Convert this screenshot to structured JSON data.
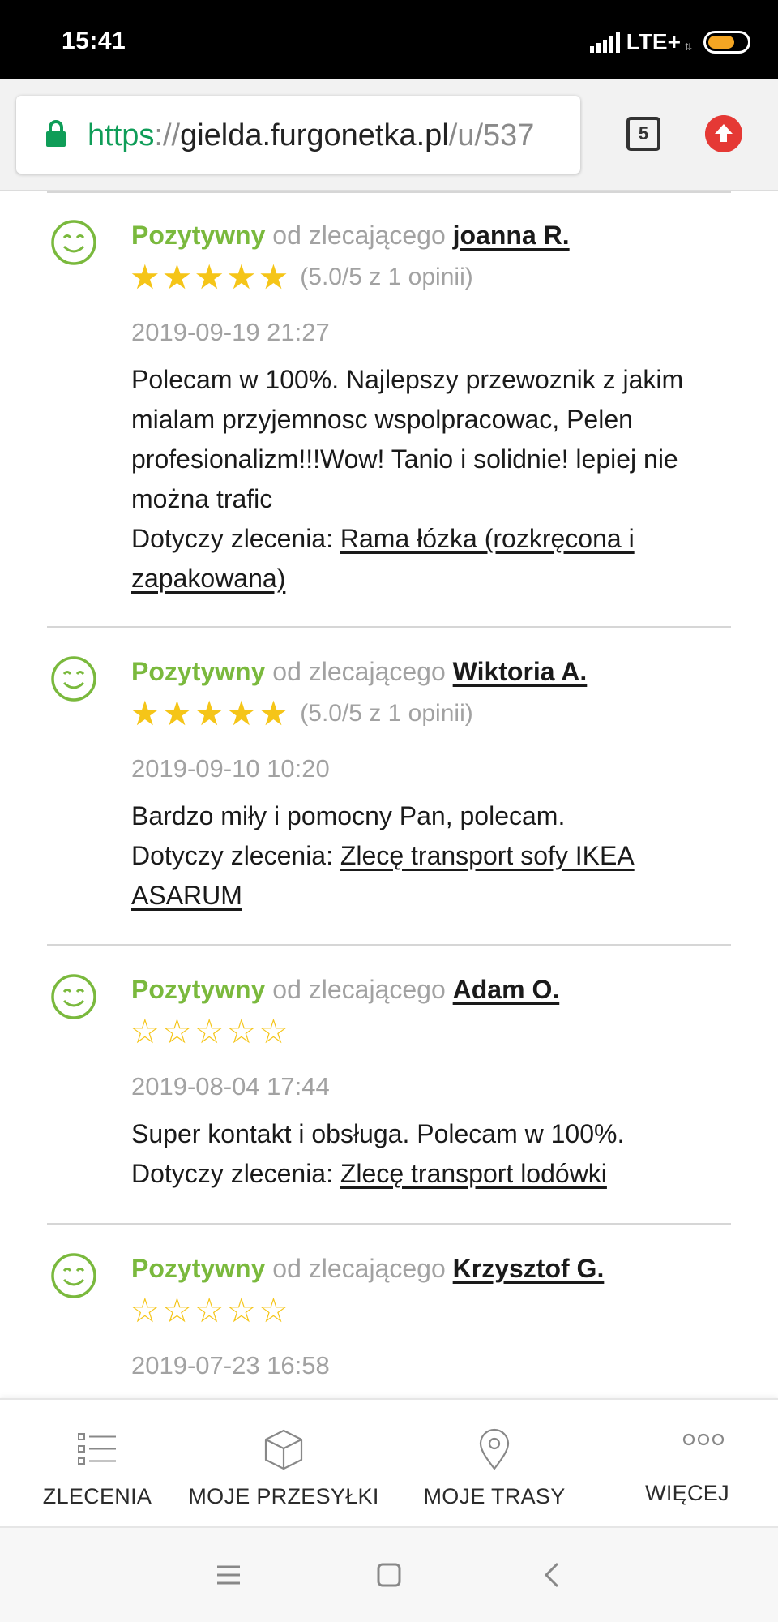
{
  "status_bar": {
    "time": "15:41",
    "network": "LTE+",
    "battery_level": 0.7,
    "battery_color": "#f5a623"
  },
  "browser": {
    "url_scheme": "https",
    "url_separator": "://",
    "url_host": "gielda.furgonetka.pl",
    "url_path": "/u/537",
    "tab_count": "5",
    "lock_icon": "lock-icon",
    "upload_icon": "upload-icon"
  },
  "colors": {
    "positive_green": "#7ab93d",
    "star_yellow": "#f5c518",
    "muted_text": "#a2a2a2",
    "url_green": "#0f9d58"
  },
  "reviews": [
    {
      "sentiment": "Pozytywny",
      "from_label": "od zlecającego",
      "author": "joanna R.",
      "stars_filled": 5,
      "rating_text": "(5.0/5 z 1 opinii)",
      "date": "2019-09-19 21:27",
      "text": "Polecam w 100%. Najlepszy przewoznik z jakim mialam przyjemnosc wspolpracowac, Pelen profesionalizm!!!Wow! Tanio i solidnie! lepiej nie można trafic",
      "order_label": "Dotyczy zlecenia:",
      "order_link": "Rama łózka (rozkręcona i zapakowana)"
    },
    {
      "sentiment": "Pozytywny",
      "from_label": "od zlecającego",
      "author": "Wiktoria A.",
      "stars_filled": 5,
      "rating_text": "(5.0/5 z 1 opinii)",
      "date": "2019-09-10 10:20",
      "text": "Bardzo miły i pomocny Pan, polecam.",
      "order_label": "Dotyczy zlecenia:",
      "order_link": "Zlecę transport sofy IKEA ASARUM"
    },
    {
      "sentiment": "Pozytywny",
      "from_label": "od zlecającego",
      "author": "Adam O.",
      "stars_filled": 0,
      "rating_text": "",
      "date": "2019-08-04 17:44",
      "text": "Super kontakt i obsługa. Polecam w 100%.",
      "order_label": "Dotyczy zlecenia:",
      "order_link": "Zlecę transport lodówki"
    },
    {
      "sentiment": "Pozytywny",
      "from_label": "od zlecającego",
      "author": "Krzysztof G.",
      "stars_filled": 0,
      "rating_text": "",
      "date": "2019-07-23 16:58",
      "text": "",
      "order_label": "",
      "order_link": ""
    }
  ],
  "bottom_nav": [
    {
      "label": "ZLECENIA",
      "icon": "list-icon"
    },
    {
      "label": "MOJE PRZESYŁKI",
      "icon": "box-icon"
    },
    {
      "label": "MOJE TRASY",
      "icon": "map-pin-icon"
    },
    {
      "label": "WIĘCEJ",
      "icon": "more-icon"
    }
  ],
  "system_nav": {
    "menu_icon": "menu-icon",
    "home_icon": "home-icon",
    "back_icon": "back-icon"
  }
}
